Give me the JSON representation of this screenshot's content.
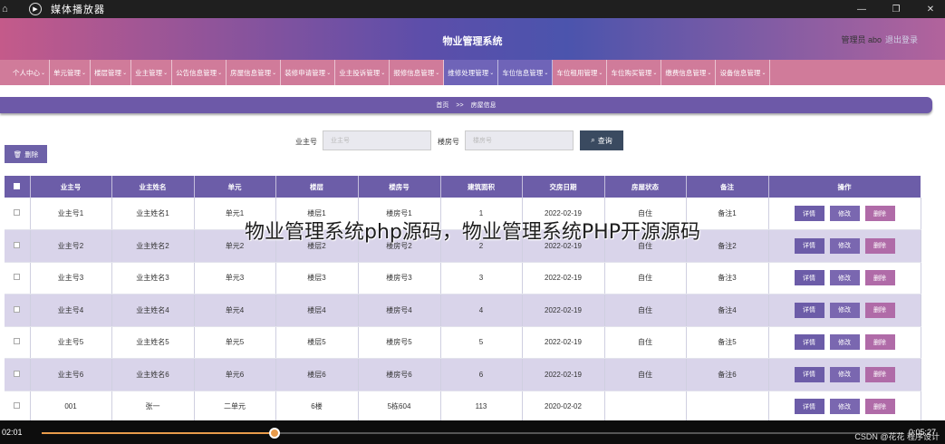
{
  "player": {
    "title": "媒体播放器",
    "current_time": "02:01",
    "duration": "0:05:27",
    "progress": 0.27,
    "watermark": "CSDN @花花 程序设计"
  },
  "header": {
    "title": "物业管理系统",
    "admin": "管理员 abo",
    "logout": "退出登录"
  },
  "nav": [
    "个人中心",
    "单元管理",
    "楼层管理",
    "业主管理",
    "公告信息管理",
    "房屋信息管理",
    "装修申请管理",
    "业主投诉管理",
    "报修信息管理",
    "维修处理管理",
    "车位信息管理",
    "车位租用管理",
    "车位购买管理",
    "缴费信息管理",
    "设备信息管理"
  ],
  "breadcrumb": {
    "home": "首页",
    "sep": ">>",
    "current": "房屋信息"
  },
  "search": {
    "owner_label": "业主号",
    "owner_placeholder": "业主号",
    "room_label": "楼房号",
    "room_placeholder": "楼房号",
    "button": "查询"
  },
  "toolbar": {
    "delete_label": "删除"
  },
  "table": {
    "headers": [
      "业主号",
      "业主姓名",
      "单元",
      "楼层",
      "楼房号",
      "建筑面积",
      "交房日期",
      "房屋状态",
      "备注",
      "操作"
    ],
    "rows": [
      [
        "业主号1",
        "业主姓名1",
        "单元1",
        "楼层1",
        "楼房号1",
        "1",
        "2022-02-19",
        "自住",
        "备注1"
      ],
      [
        "业主号2",
        "业主姓名2",
        "单元2",
        "楼层2",
        "楼房号2",
        "2",
        "2022-02-19",
        "自住",
        "备注2"
      ],
      [
        "业主号3",
        "业主姓名3",
        "单元3",
        "楼层3",
        "楼房号3",
        "3",
        "2022-02-19",
        "自住",
        "备注3"
      ],
      [
        "业主号4",
        "业主姓名4",
        "单元4",
        "楼层4",
        "楼房号4",
        "4",
        "2022-02-19",
        "自住",
        "备注4"
      ],
      [
        "业主号5",
        "业主姓名5",
        "单元5",
        "楼层5",
        "楼房号5",
        "5",
        "2022-02-19",
        "自住",
        "备注5"
      ],
      [
        "业主号6",
        "业主姓名6",
        "单元6",
        "楼层6",
        "楼房号6",
        "6",
        "2022-02-19",
        "自住",
        "备注6"
      ],
      [
        "001",
        "张一",
        "二单元",
        "6楼",
        "5栋604",
        "113",
        "2020-02-02",
        "",
        ""
      ]
    ],
    "actions": {
      "detail": "详情",
      "edit": "修改",
      "delete": "删除"
    }
  },
  "caption": "物业管理系统php源码，物业管理系统PHP开源源码"
}
